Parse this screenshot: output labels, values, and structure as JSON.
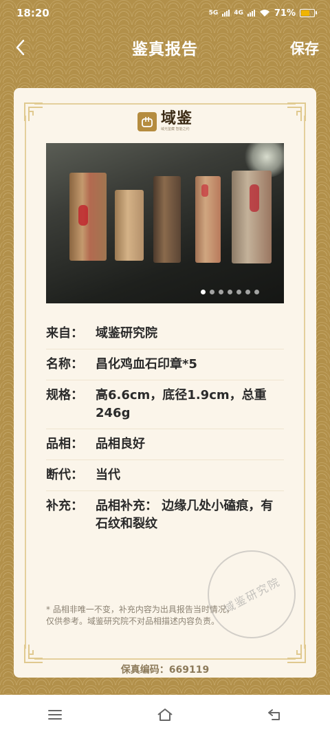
{
  "status_bar": {
    "time": "18:20",
    "net1": "5G",
    "net2": "4G",
    "battery_text": "71%"
  },
  "nav": {
    "title": "鉴真报告",
    "save_label": "保存",
    "back_icon": "chevron-left-icon"
  },
  "brand": {
    "name": "域鉴",
    "tagline": "域光鉴藏 智能之约"
  },
  "gallery": {
    "total_dots": 7,
    "active_dot": 1
  },
  "report": {
    "rows": [
      {
        "label": "来自：",
        "value": "域鉴研究院"
      },
      {
        "label": "名称：",
        "value": "昌化鸡血石印章*5"
      },
      {
        "label": "规格：",
        "value": " 高6.6cm，底径1.9cm，总重246g"
      },
      {
        "label": "品相：",
        "value": " 品相良好"
      },
      {
        "label": "断代：",
        "value": "当代"
      },
      {
        "label": "补充：",
        "value": "品相补充： 边缘几处小磕痕，有石纹和裂纹"
      }
    ],
    "note": "* 品相非唯一不变，补充内容为出具报告当时情况，\n   仅供参考。域鉴研究院不对品相描述内容负责。",
    "stamp_text": "域鉴研究院",
    "serial": "保真编码：669119"
  },
  "colors": {
    "gold": "#b2904a",
    "card": "#fbf5ea",
    "battery": "#f0b400"
  },
  "bottom_nav": {
    "icons": [
      "menu-icon",
      "home-icon",
      "back-arrow-icon"
    ]
  }
}
